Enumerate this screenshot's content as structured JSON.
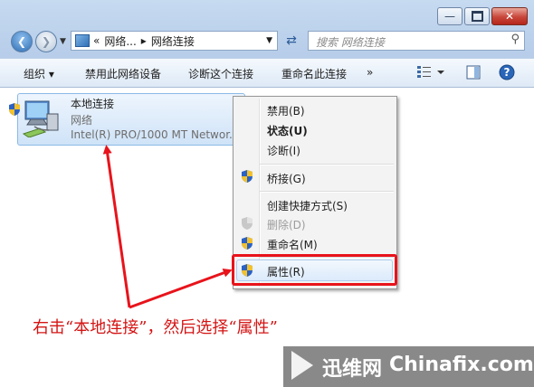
{
  "nav": {
    "breadcrumb_prefix": "«",
    "breadcrumb_1": "网络...",
    "breadcrumb_sep": "▸",
    "breadcrumb_2": "网络连接",
    "search_placeholder": "搜索 网络连接"
  },
  "toolbar": {
    "organize": "组织 ▾",
    "disable_device": "禁用此网络设备",
    "diagnose": "诊断这个连接",
    "rename": "重命名此连接",
    "more": "»"
  },
  "connection": {
    "name": "本地连接",
    "network": "网络",
    "adapter": "Intel(R) PRO/1000 MT Networ..."
  },
  "context_menu": {
    "disable": "禁用(B)",
    "status": "状态(U)",
    "diagnose": "诊断(I)",
    "bridge": "桥接(G)",
    "create_shortcut": "创建快捷方式(S)",
    "delete": "删除(D)",
    "rename": "重命名(M)",
    "properties": "属性(R)"
  },
  "annotation": {
    "caption": "右击“本地连接”，然后选择“属性”"
  },
  "watermark": {
    "brand_cn": "迅维网",
    "brand_en": "Chinafix.com"
  },
  "colors": {
    "annotation_red": "#e8131b"
  }
}
